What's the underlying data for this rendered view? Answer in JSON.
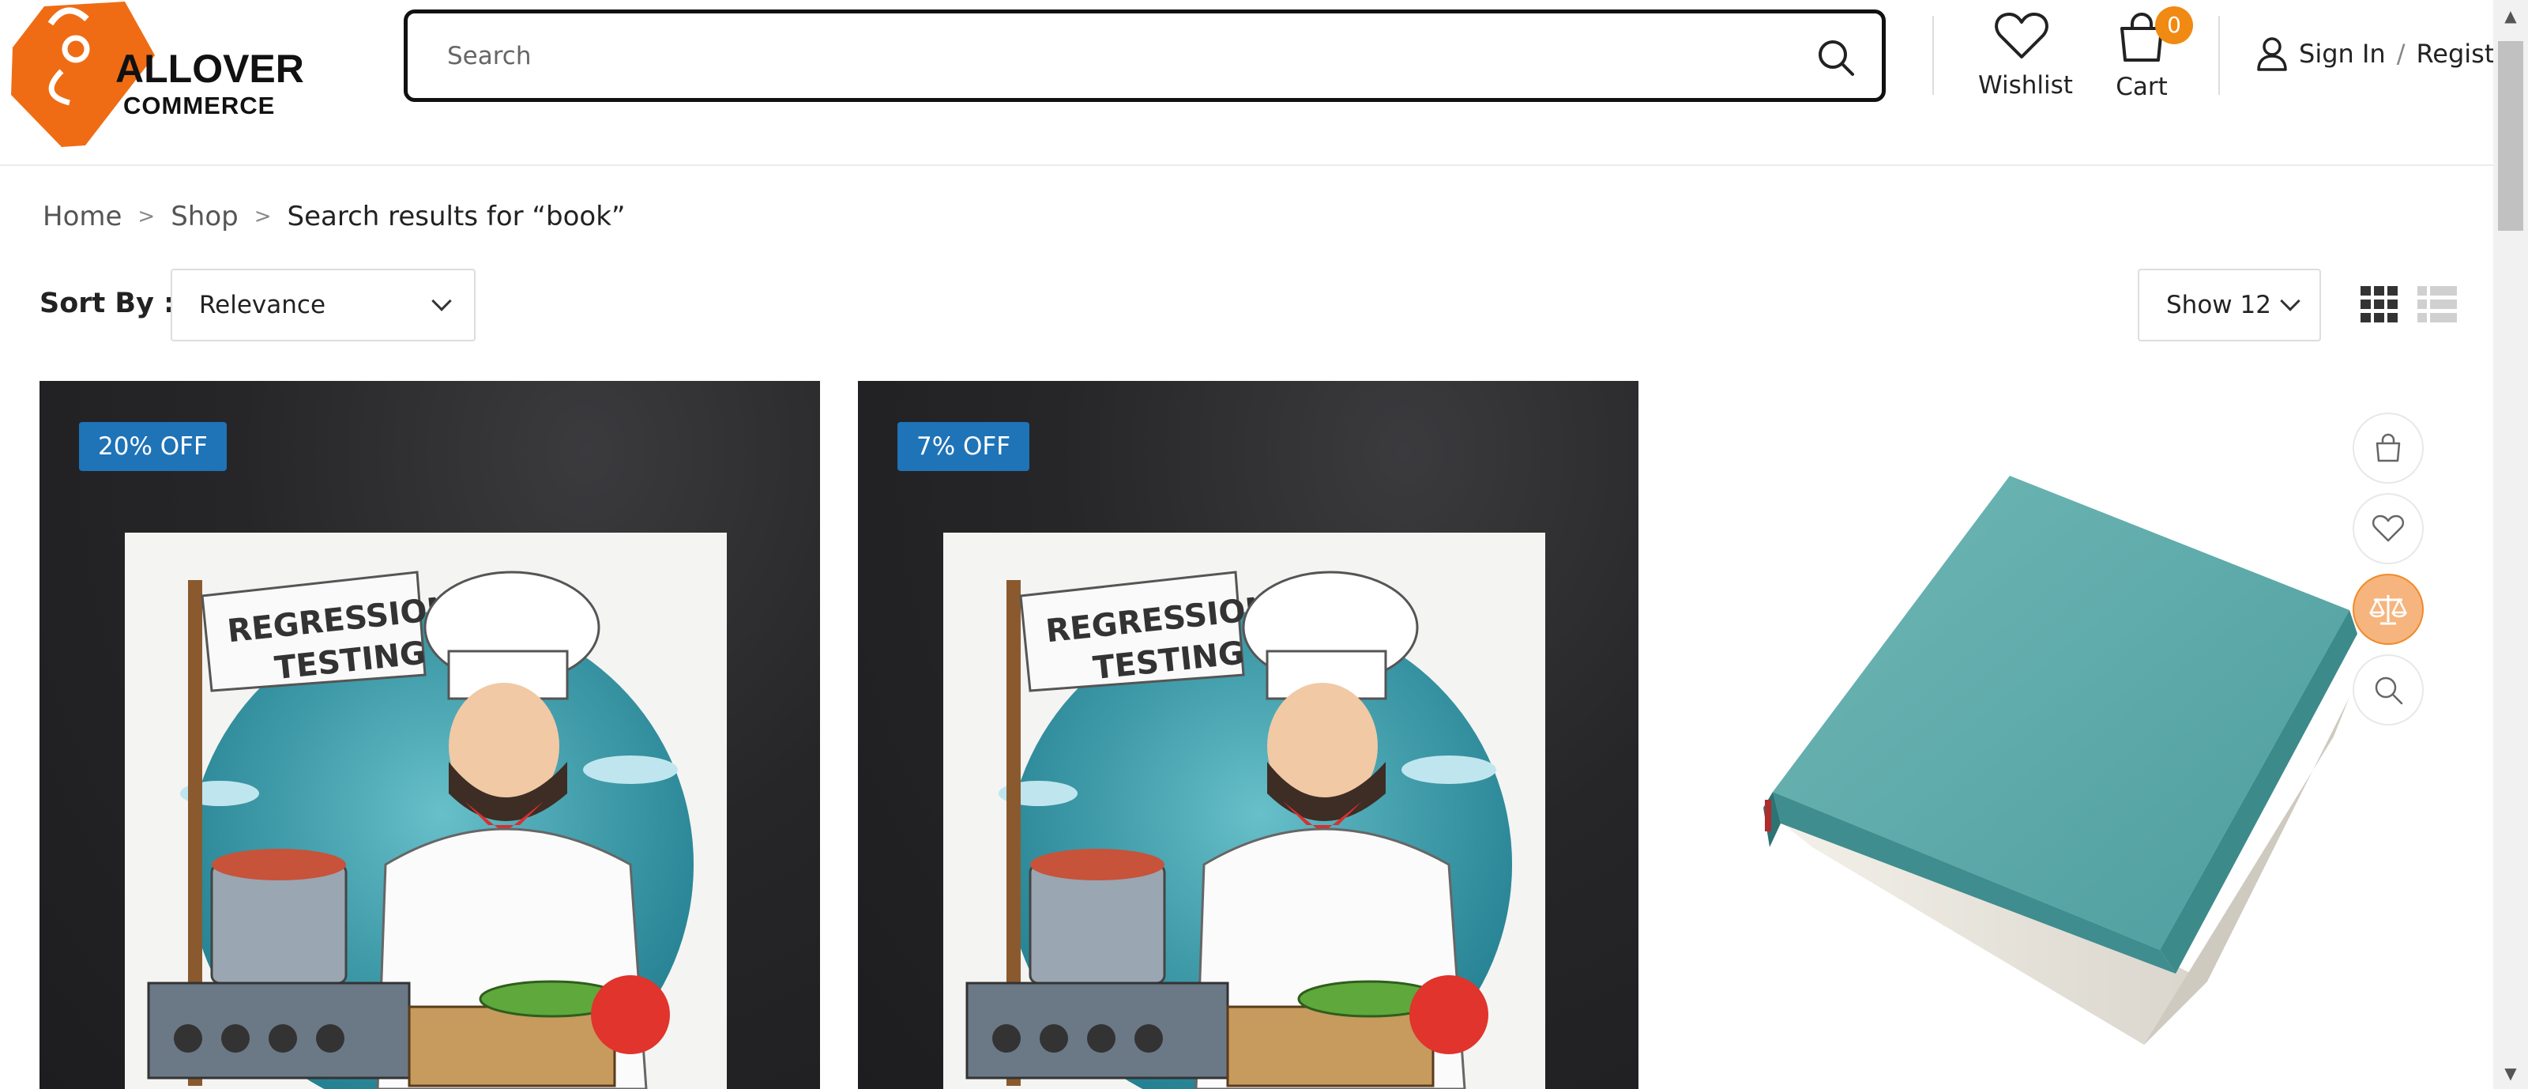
{
  "logo": {
    "line1": "ALLOVER",
    "line2": "COMMERCE",
    "brand_color": "#ef6c14"
  },
  "search": {
    "placeholder": "Search",
    "value": ""
  },
  "header": {
    "wishlist_label": "Wishlist",
    "cart_label": "Cart",
    "cart_count": "0",
    "signin_label": "Sign In",
    "slash": "/",
    "register_label": "Register"
  },
  "breadcrumb": {
    "items": [
      "Home",
      "Shop"
    ],
    "separator": ">",
    "current": "Search results for “book”"
  },
  "toolbar": {
    "sort_label": "Sort By :",
    "sort_value": "Relevance",
    "show_value": "Show 12",
    "views": [
      "grid-view-icon",
      "list-view-icon"
    ]
  },
  "products": [
    {
      "badge": "20% OFF",
      "image_text": [
        "REGRESSION",
        "TESTING"
      ]
    },
    {
      "badge": "7% OFF",
      "image_text": [
        "REGRESSION",
        "TESTING"
      ]
    },
    {
      "badge": "",
      "image": "teal-book"
    }
  ],
  "quick_actions": [
    "shopping-bag-icon",
    "heart-icon",
    "compare-scale-icon",
    "search-icon"
  ],
  "colors": {
    "badge": "#1f73b7",
    "accent": "#f08a12",
    "compare_active": "#f6b57e"
  }
}
